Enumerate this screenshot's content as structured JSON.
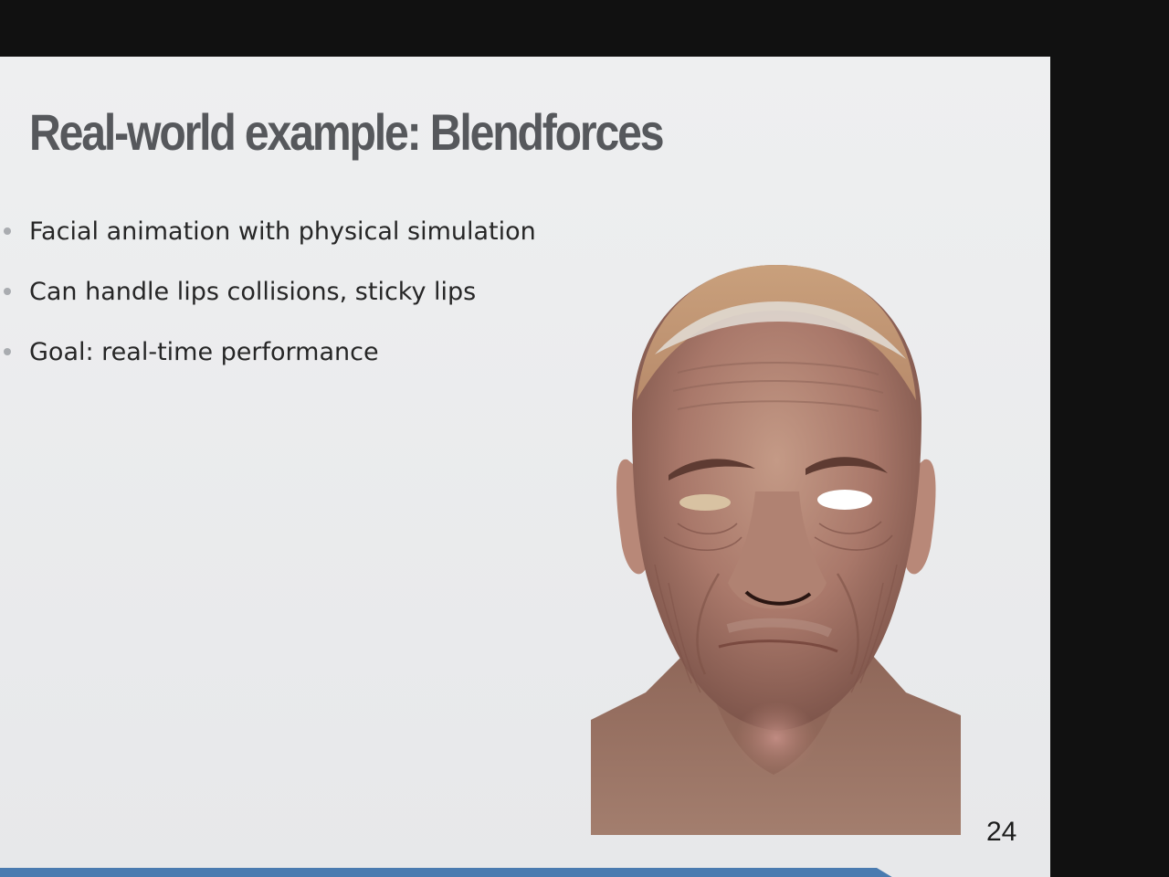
{
  "slide": {
    "title": "Real-world example: Blendforces",
    "bullets": [
      "Facial animation with physical simulation",
      "Can handle lips collisions, sticky lips",
      "Goal: real-time performance"
    ],
    "page_number": "24",
    "figure": "rendered-3d-face-head-model"
  },
  "colors": {
    "background": "#111111",
    "slide_background": "#eaebed",
    "title": "#56585c",
    "text": "#262626",
    "bullet": "#a9acb0",
    "accent_bar": "#4a7bb0"
  }
}
